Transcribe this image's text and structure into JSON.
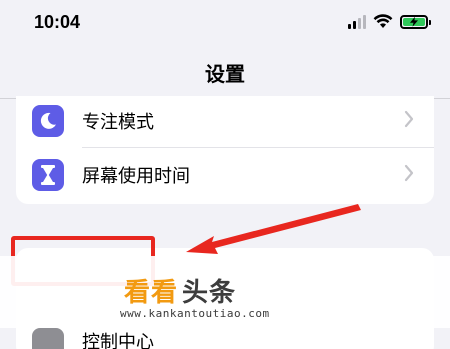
{
  "status_bar": {
    "time": "10:04",
    "battery_level": 1.0,
    "battery_color": "#30c85a"
  },
  "header": {
    "title": "设置"
  },
  "settings_group": {
    "items": [
      {
        "label": "专注模式",
        "icon": "moon-icon",
        "icon_color": "#5e5ce6"
      },
      {
        "label": "屏幕使用时间",
        "icon": "hourglass-icon",
        "icon_color": "#5e5ce6"
      }
    ]
  },
  "next_group": {
    "partial_item": {
      "label": "控制中心",
      "icon": "control-center-icon",
      "icon_color": "#8e8e93"
    }
  },
  "annotation": {
    "highlight_color": "#e8271f"
  },
  "watermark": {
    "part1": "看看",
    "part2": "头条",
    "url": "www.kankantoutiao.com",
    "accent_color": "#f29a11"
  }
}
